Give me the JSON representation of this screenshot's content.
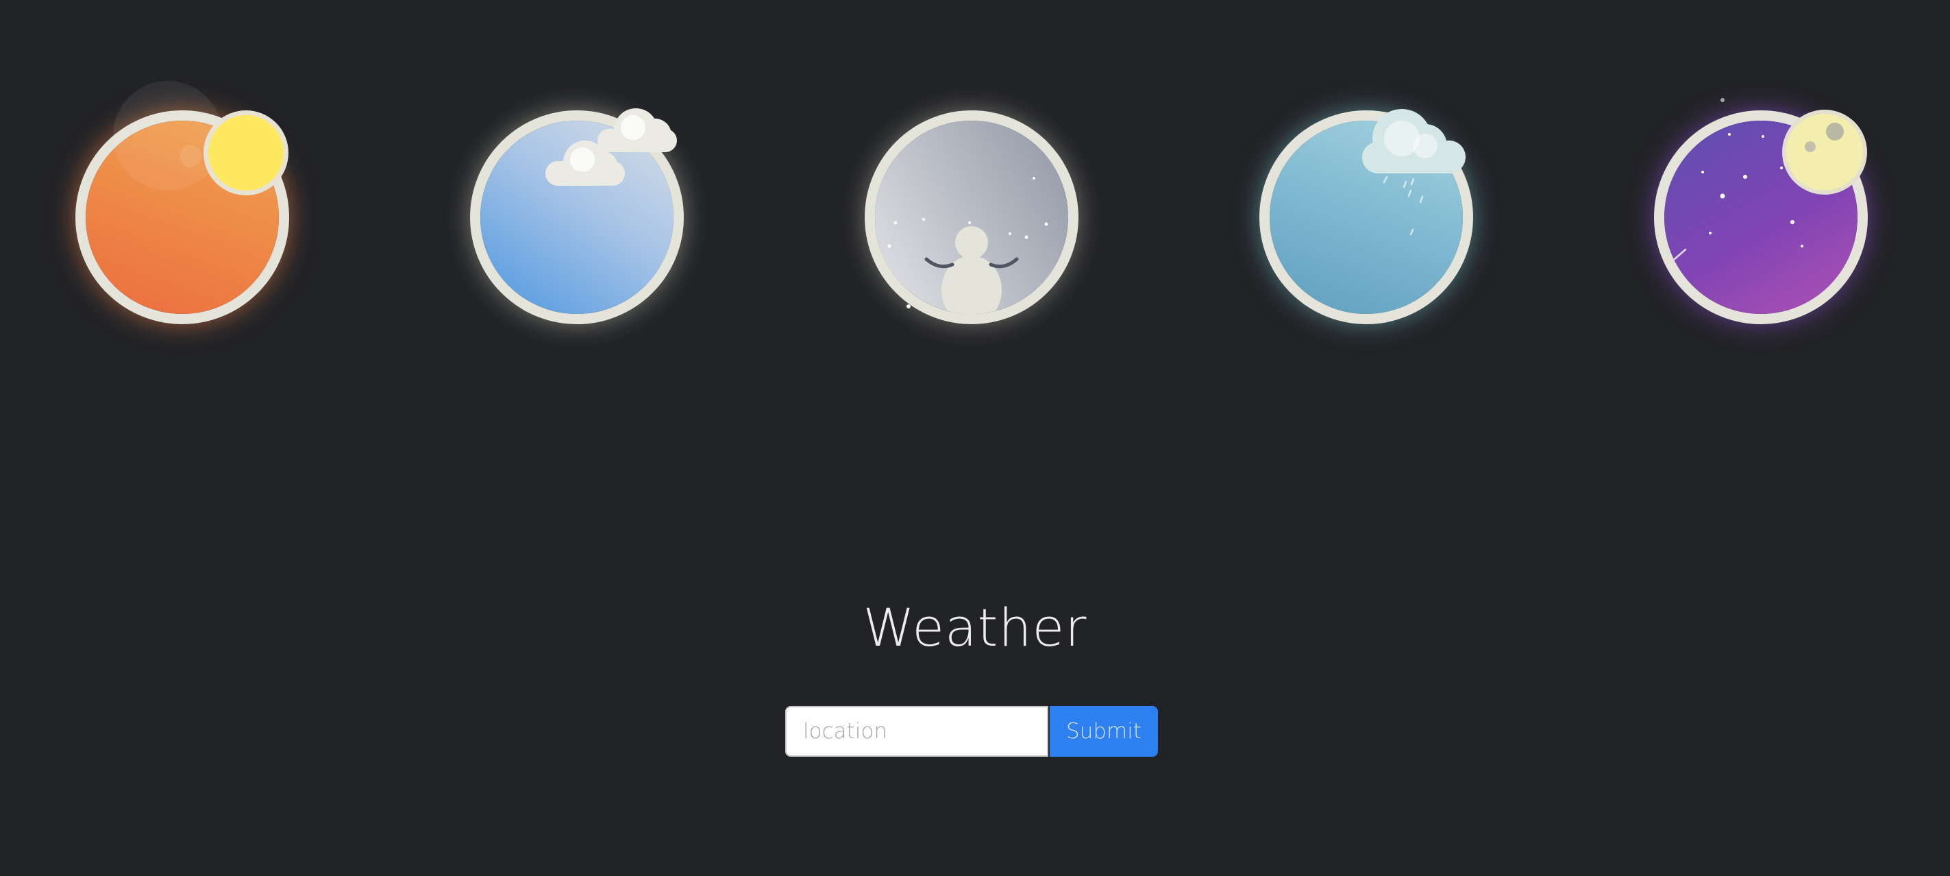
{
  "title": "Weather",
  "search": {
    "placeholder": "location",
    "value": "",
    "submit_label": "Submit"
  },
  "weather_orbs": [
    {
      "name": "sunny",
      "icon": "sun-icon",
      "colors": [
        "#f0a451",
        "#ec6d3e"
      ]
    },
    {
      "name": "cloudy",
      "icon": "cloud-icon",
      "colors": [
        "#d8dfe7",
        "#4d97e0"
      ]
    },
    {
      "name": "snowy",
      "icon": "snowman-icon",
      "colors": [
        "#e4e5e8",
        "#8f97a5"
      ]
    },
    {
      "name": "rainy",
      "icon": "rain-cloud-icon",
      "colors": [
        "#a5d3df",
        "#5f9fbf"
      ]
    },
    {
      "name": "clear-night",
      "icon": "moon-icon",
      "colors": [
        "#5d4fb0",
        "#b052b4"
      ]
    }
  ],
  "accent_color": "#2e7ff0",
  "background_color": "#222327"
}
